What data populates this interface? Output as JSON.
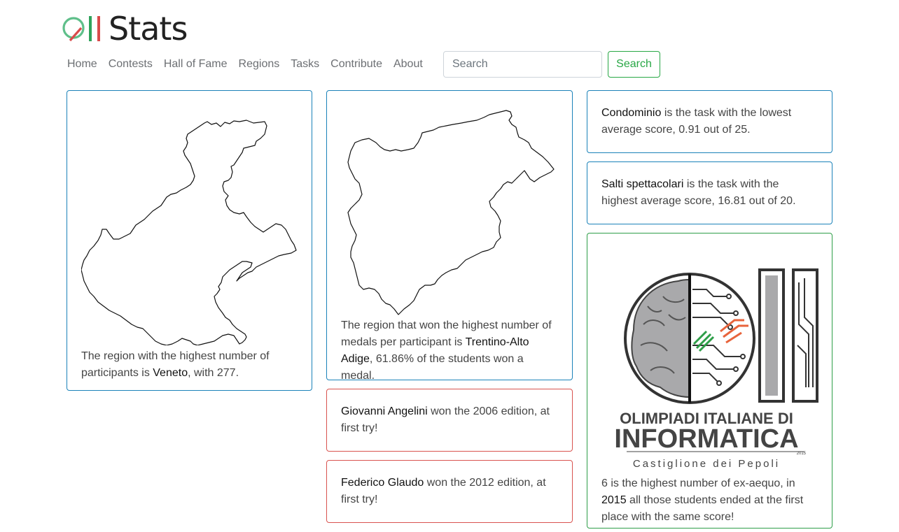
{
  "brand": {
    "name": "Stats"
  },
  "nav": {
    "items": [
      "Home",
      "Contests",
      "Hall of Fame",
      "Regions",
      "Tasks",
      "Contribute",
      "About"
    ]
  },
  "search": {
    "placeholder": "Search",
    "value": "",
    "button_label": "Search"
  },
  "cards": {
    "participants": {
      "pre": "The region with the highest number of participants is ",
      "region": "Veneto",
      "post": ", with 277."
    },
    "medals": {
      "pre": "The region that won the highest number of medals per participant is ",
      "region": "Trentino-Alto Adige",
      "post": ", 61.86% of the students won a medal."
    },
    "lowest_task": {
      "task": "Condominio",
      "post": " is the task with the lowest average score, 0.91 out of 25."
    },
    "highest_task": {
      "task": "Salti spettacolari",
      "post": " is the task with the highest average score, 16.81 out of 20."
    },
    "first_try_1": {
      "name": "Giovanni Angelini",
      "post": " won the 2006 edition, at first try!"
    },
    "first_try_2": {
      "name": "Federico Glaudo",
      "post": " won the 2012 edition, at first try!"
    },
    "ex_aequo": {
      "pre": "6 is the highest number of ex-aequo, in ",
      "year": "2015",
      "post": " all those students ended at the first place with the same score!",
      "logo": {
        "line1": "OLIMPIADI ITALIANE DI",
        "line2": "INFORMATICA",
        "year": "2015",
        "location": "Castiglione dei Pepoli"
      }
    }
  },
  "colors": {
    "blue": "#1b82b9",
    "red": "#d9534f",
    "green": "#2e9e48"
  }
}
